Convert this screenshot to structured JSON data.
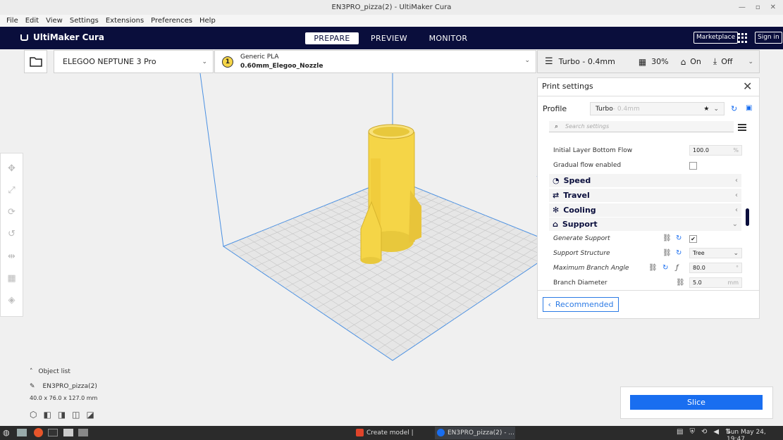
{
  "window": {
    "title": "EN3PRO_pizza(2) - UltiMaker Cura"
  },
  "menu": {
    "items": [
      "File",
      "Edit",
      "View",
      "Settings",
      "Extensions",
      "Preferences",
      "Help"
    ]
  },
  "header": {
    "logo_text": "UltiMaker Cura",
    "tabs": [
      "PREPARE",
      "PREVIEW",
      "MONITOR"
    ],
    "active_tab": "PREPARE",
    "marketplace_label": "Marketplace",
    "signin_label": "Sign in"
  },
  "toolbar": {
    "printer_name": "ELEGOO NEPTUNE 3 Pro",
    "material_badge": "1",
    "material_name": "Generic PLA",
    "nozzle_name": "0.60mm_Elegoo_Nozzle",
    "profile_summary": "Turbo - 0.4mm",
    "infill": "30%",
    "support": "On",
    "adhesion": "Off"
  },
  "print_settings": {
    "title": "Print settings",
    "profile_label": "Profile",
    "profile_name": "Turbo",
    "profile_suffix": " - 0.4mm",
    "search_placeholder": "Search settings",
    "rows": {
      "initial_layer_bottom_flow": {
        "label": "Initial Layer Bottom Flow",
        "value": "100.0",
        "unit": "%"
      },
      "gradual_flow": {
        "label": "Gradual flow enabled"
      },
      "generate_support": {
        "label": "Generate Support",
        "checked": true
      },
      "support_structure": {
        "label": "Support Structure",
        "value": "Tree"
      },
      "max_branch_angle": {
        "label": "Maximum Branch Angle",
        "value": "80.0",
        "unit": "°"
      },
      "branch_diameter": {
        "label": "Branch Diameter",
        "value": "5.0",
        "unit": "mm"
      }
    },
    "categories": {
      "speed": "Speed",
      "travel": "Travel",
      "cooling": "Cooling",
      "support": "Support"
    },
    "recommended_label": "Recommended"
  },
  "slice": {
    "button_label": "Slice"
  },
  "object_list": {
    "header": "Object list",
    "object_name": "EN3PRO_pizza(2)",
    "dimensions": "40.0 x 76.0 x 127.0 mm"
  },
  "taskbar": {
    "tasks": [
      "Create model | Print...",
      "EN3PRO_pizza(2) - ..."
    ],
    "clock": "Sun May 24, 19:47"
  },
  "colors": {
    "header_bg": "#0a0e3c",
    "accent": "#196ef0",
    "model": "#f5d547",
    "bed_line": "#4a90e2"
  }
}
